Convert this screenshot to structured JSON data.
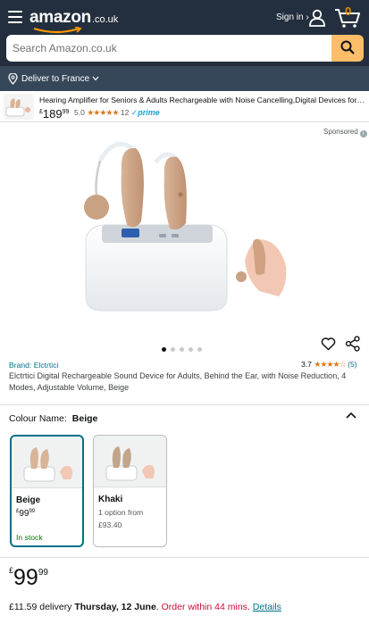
{
  "header": {
    "logo_text": "amazon",
    "logo_domain": ".co.uk",
    "signin_label": "Sign in ›",
    "cart_count": "0"
  },
  "search": {
    "placeholder": "Search Amazon.co.uk"
  },
  "deliver_to": "Deliver to France",
  "sponsored_product": {
    "title": "Hearing Amplifier for Seniors & Adults Rechargeable with Noise Cancelling,Digital Devices for Sup...",
    "price_currency": "£",
    "price_whole": "189",
    "price_fraction": "99",
    "rating": "5.0",
    "stars": "★★★★★",
    "review_count": "12",
    "prime_label": "✓prime"
  },
  "sponsored_label": "Sponsored",
  "image_carousel": {
    "total": 5,
    "active": 0
  },
  "product": {
    "brand": "Brand: Elctrtici",
    "rating": "3.7",
    "stars": "★★★★☆",
    "review_count": "(5)",
    "title": "Elctrtici Digital Rechargeable Sound Device for Adults, Behind the Ear, with Noise Reduction, 4 Modes, Adjustable Volume, Beige"
  },
  "colour": {
    "label": "Colour Name:",
    "selected": "Beige",
    "options": [
      {
        "name": "Beige",
        "price_currency": "£",
        "price_whole": "99",
        "price_fraction": "99",
        "stock": "In stock"
      },
      {
        "name": "Khaki",
        "sub": "1 option from",
        "sub_price": "£93.40"
      }
    ]
  },
  "price": {
    "currency": "£",
    "whole": "99",
    "fraction": "99"
  },
  "delivery": {
    "fee": "£11.59 delivery ",
    "date": "Thursday, 12 June",
    "sep": ". ",
    "order_within": "Order within 44 mins",
    "period": ". ",
    "details": "Details"
  },
  "colors": {
    "header": "#232f3e",
    "subheader": "#37475a",
    "accent": "#febd69",
    "link": "#007185",
    "deal_red": "#cc0c39",
    "stock_green": "#007600",
    "star": "#de7921"
  }
}
